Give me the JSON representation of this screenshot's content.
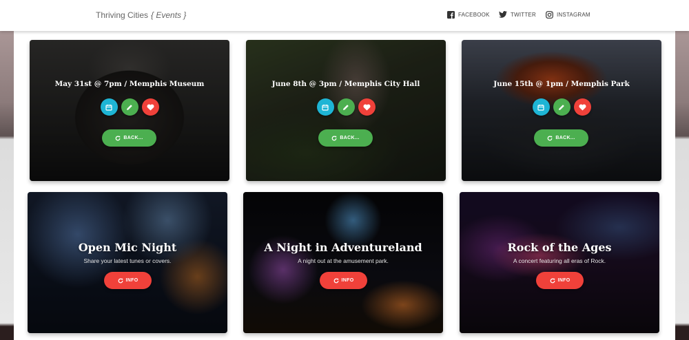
{
  "header": {
    "brand": "Thriving Cities",
    "brand_sub": "{ Events }",
    "social": [
      {
        "label": "FACEBOOK",
        "icon": "facebook-icon"
      },
      {
        "label": "TWITTER",
        "icon": "twitter-icon"
      },
      {
        "label": "INSTAGRAM",
        "icon": "instagram-icon"
      }
    ]
  },
  "colors": {
    "calendar": "#1eb5d5",
    "edit": "#4caf50",
    "heart": "#f0413a",
    "back_button": "#4caf50",
    "info_button": "#f0413a"
  },
  "back_cards": [
    {
      "date": "May 31st @ 7pm / Memphis Museum",
      "button": "BACK..."
    },
    {
      "date": "June 8th @ 3pm / Memphis City Hall",
      "button": "BACK..."
    },
    {
      "date": "June 15th @ 1pm / Memphis Park",
      "button": "BACK..."
    }
  ],
  "front_cards": [
    {
      "title": "Open Mic Night",
      "subtitle": "Share your latest tunes or covers.",
      "button": "INFO"
    },
    {
      "title": "A Night in Adventureland",
      "subtitle": "A night out at the amusement park.",
      "button": "INFO"
    },
    {
      "title": "Rock of the Ages",
      "subtitle": "A concert featuring all eras of Rock.",
      "button": "INFO"
    }
  ]
}
